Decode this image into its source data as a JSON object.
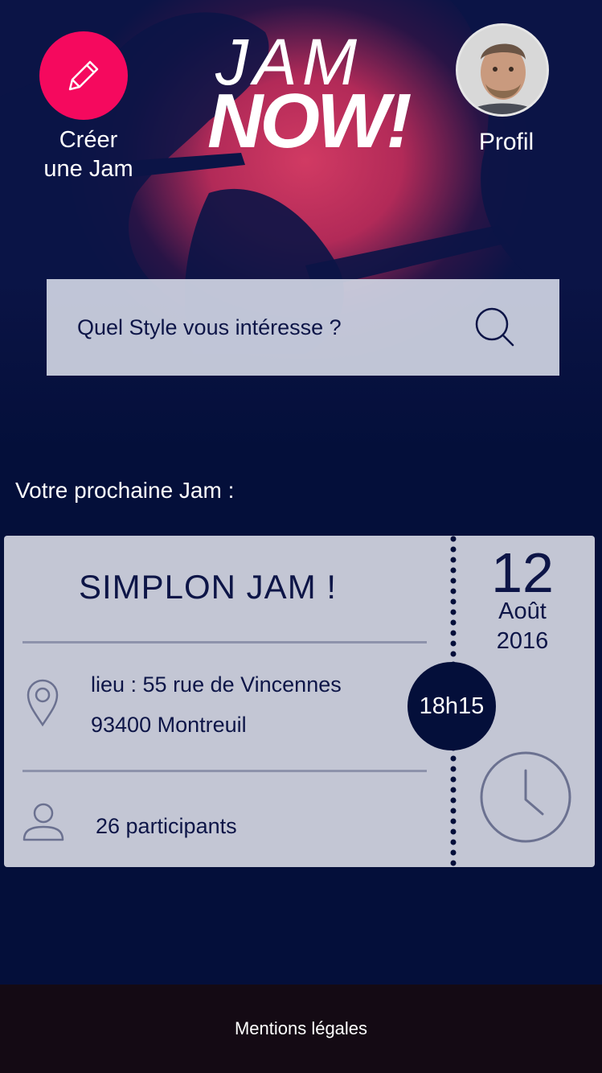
{
  "header": {
    "create_label": "Créer\nune Jam",
    "logo_line1": "JAM",
    "logo_line2": "NOW!",
    "profile_label": "Profil"
  },
  "search": {
    "placeholder": "Quel Style vous intéresse ?"
  },
  "next_jam": {
    "section_label": "Votre prochaine Jam :",
    "title": "SIMPLON JAM !",
    "address_line1": "lieu : 55 rue de Vincennes",
    "address_line2": "93400 Montreuil",
    "participants": "26 participants",
    "day": "12",
    "month": "Août",
    "year": "2016",
    "time": "18h15"
  },
  "footer": {
    "legal_link": "Mentions légales"
  },
  "colors": {
    "accent": "#f5095e",
    "background": "#040f3a",
    "card": "#c3c6d4",
    "text_dark": "#0d1547"
  }
}
